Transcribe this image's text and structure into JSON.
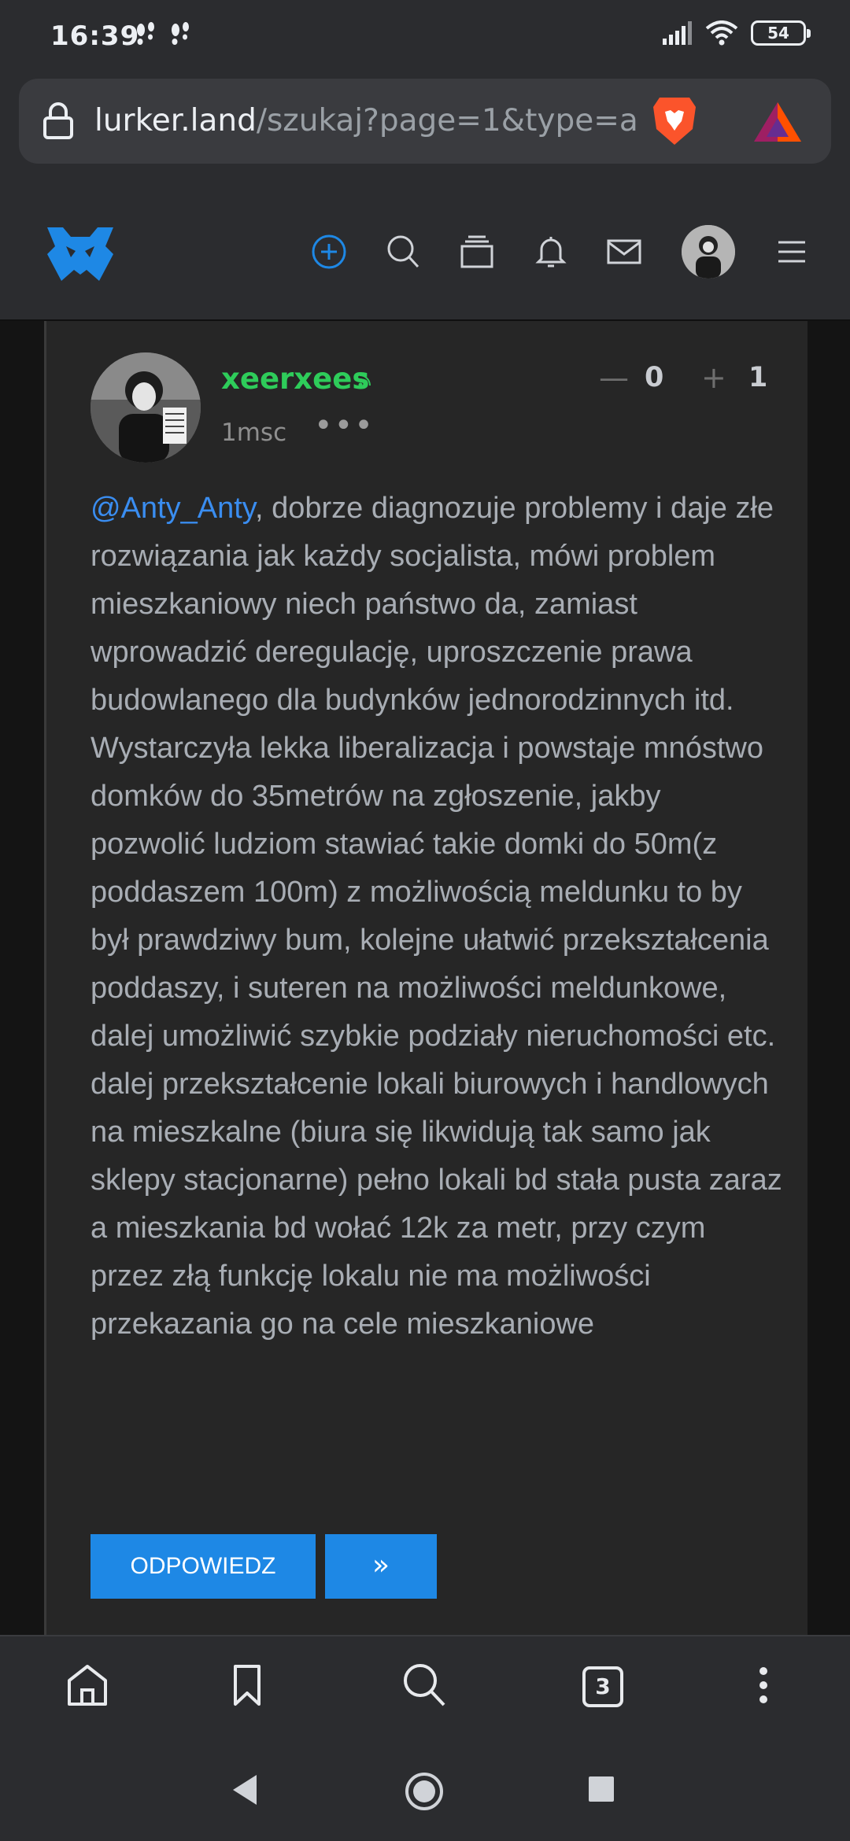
{
  "status_bar": {
    "time": "16:39",
    "battery": "54",
    "notification_icons": [
      "footprint-icon",
      "footprint-icon"
    ],
    "system_icons": [
      "signal-icon",
      "wifi-icon",
      "battery-icon"
    ]
  },
  "browser": {
    "url_host": "lurker.land",
    "url_path": "/szukaj?page=1&type=a",
    "icons": [
      "lock-icon",
      "brave-shield-icon",
      "bat-rewards-icon"
    ]
  },
  "site_header": {
    "icons": [
      "lurker-logo-icon",
      "add-icon",
      "search-icon",
      "stack-icon",
      "bell-icon",
      "mail-icon",
      "avatar",
      "menu-icon"
    ],
    "accent_color": "#1e88e5"
  },
  "post": {
    "username": "xeerxees",
    "time": "1msc",
    "more": "•••",
    "vote_minus": "—",
    "vote_down": "0",
    "vote_plus": "+",
    "vote_up": "1",
    "mention": "@Anty_Anty",
    "body": ", dobrze diagnozuje problemy i daje złe rozwiązania jak każdy socjalista, mówi problem mieszkaniowy niech państwo da, zamiast wprowadzić deregulację, uproszczenie prawa budowlanego dla budynków jednorodzinnych itd. Wystarczyła lekka liberalizacja i powstaje mnóstwo domków do 35metrów na zgłoszenie, jakby pozwolić ludziom stawiać takie domki do 50m(z poddaszem 100m) z możliwością meldunku to by był prawdziwy bum, kolejne ułatwić przekształcenia poddaszy, i suteren na możliwości meldunkowe, dalej umożliwić szybkie podziały nieruchomości etc. dalej przekształcenie lokali biurowych i handlowych na mieszkalne (biura się likwidują tak samo jak sklepy stacjonarne) pełno lokali bd stała pusta zaraz a mieszkania bd wołać 12k za metr, przy czym przez złą funkcję lokalu nie ma możliwości przekazania go na cele mieszkaniowe",
    "reply_label": "ODPOWIEDZ",
    "more_label": "»",
    "username_color": "#2ecc5a",
    "mention_color": "#3a8df0"
  },
  "browser_toolbar": {
    "tabs_count": "3",
    "icons": [
      "home-icon",
      "bookmark-icon",
      "search-icon",
      "tabs-icon",
      "kebab-menu-icon"
    ]
  },
  "nav_bar": {
    "icons": [
      "back-icon",
      "home-circle-icon",
      "recents-icon"
    ]
  }
}
